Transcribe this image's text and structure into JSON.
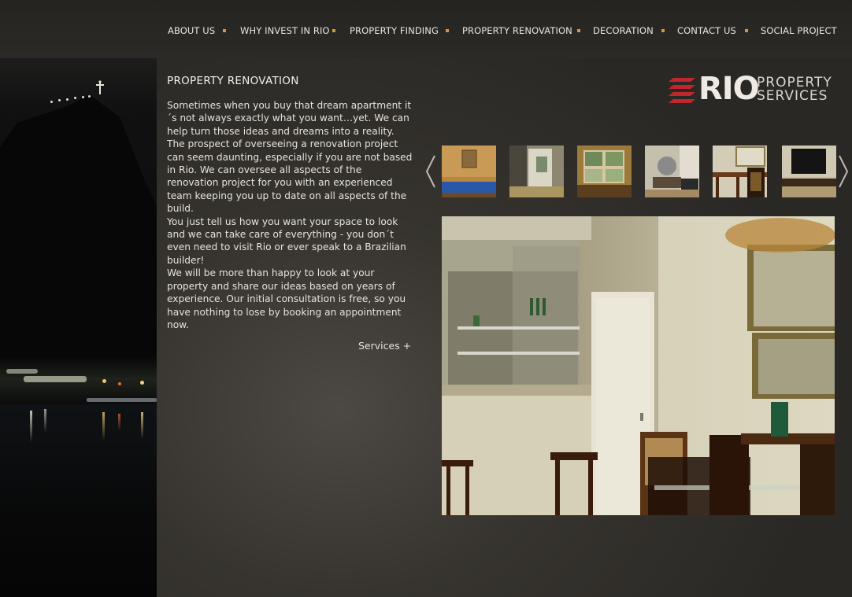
{
  "nav": {
    "items": [
      {
        "label": "ABOUT US"
      },
      {
        "label": "WHY INVEST IN RIO"
      },
      {
        "label": "PROPERTY FINDING"
      },
      {
        "label": "PROPERTY RENOVATION"
      },
      {
        "label": "DECORATION"
      },
      {
        "label": "CONTACT US"
      },
      {
        "label": "SOCIAL PROJECT"
      }
    ],
    "separator_color": "#d8953d"
  },
  "logo": {
    "wordmark": "RIO",
    "line1": "PROPERTY",
    "line2": "SERVICES",
    "accent_color": "#c0272d"
  },
  "content": {
    "title": "PROPERTY RENOVATION",
    "paragraphs": [
      "Sometimes when you buy that dream apartment it´s not always exactly what you want…yet. We can help turn those ideas and dreams into a reality. The prospect of overseeing a renovation project can seem daunting, especially if you are not based in Rio. We can oversee all aspects of the renovation project for you with an experienced team keeping you up to date on all aspects of the build.",
      "You just tell us how you want your space to look and we can take care of everything - you don´t even need to visit Rio or ever speak to a Brazilian builder!",
      "We will be more than happy to look at your property and share our ideas based on years of experience. Our initial consultation is free, so you have nothing to lose by booking an appointment now."
    ],
    "services_link": "Services  +"
  },
  "gallery": {
    "prev_icon": "chevron-left-icon",
    "next_icon": "chevron-right-icon",
    "thumbnails": [
      {
        "name": "bedroom-thumbnail"
      },
      {
        "name": "doorway-thumbnail"
      },
      {
        "name": "window-thumbnail"
      },
      {
        "name": "living-room-thumbnail"
      },
      {
        "name": "dining-thumbnail"
      },
      {
        "name": "tv-room-thumbnail"
      }
    ]
  }
}
